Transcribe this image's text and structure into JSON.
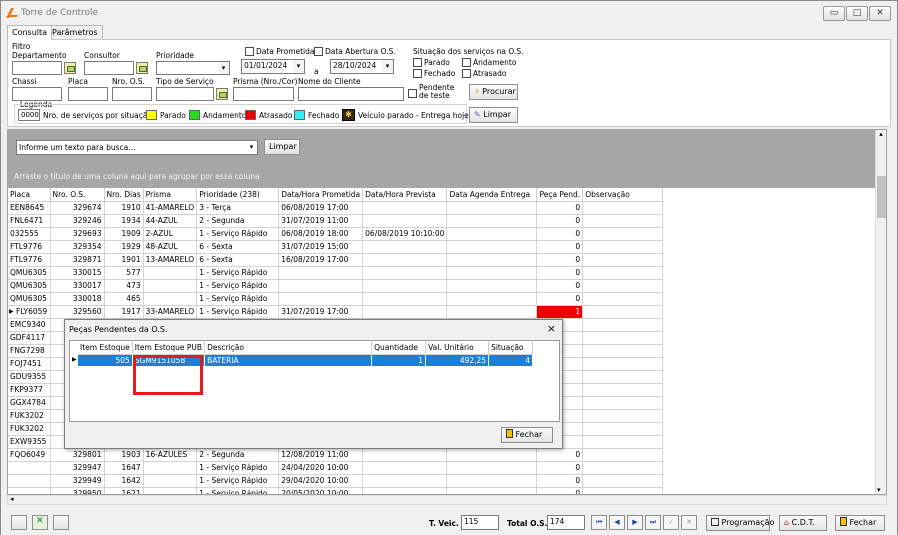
{
  "window": {
    "title": "Torre de Controle"
  },
  "tabs": [
    "Consulta",
    "Parâmetros"
  ],
  "filters": {
    "group_label": "Filtro",
    "departamento_label": "Departamento",
    "consultor_label": "Consultor",
    "prioridade_label": "Prioridade",
    "data_prometida_label": "Data Prometida",
    "data_abertura_label": "Data Abertura O.S.",
    "date_from": "01/01/2024",
    "date_sep": "a",
    "date_to": "28/10/2024",
    "situacao_label": "Situação dos serviços na O.S.",
    "parado": "Parado",
    "andamento": "Andamento",
    "fechado": "Fechado",
    "atrasado": "Atrasado",
    "chassi_label": "Chassi",
    "placa_label": "Placa",
    "nro_os_label": "Nro. O.S.",
    "tipo_servico_label": "Tipo de Serviço",
    "prisma_label": "Prisma (Nro./Cor)",
    "nome_cliente_label": "Nome do Cliente",
    "pendente_teste": "Pendente de teste",
    "procurar": "Procurar",
    "limpar": "Limpar"
  },
  "legend": {
    "title": "Legenda",
    "code": "0000",
    "code_text": "Nro. de serviços por situação",
    "items": [
      {
        "label": "Parado",
        "color": "#ffff00"
      },
      {
        "label": "Andamento",
        "color": "#22dd22"
      },
      {
        "label": "Atrasado",
        "color": "#ee0000"
      },
      {
        "label": "Fechado",
        "color": "#33eeee"
      }
    ],
    "vehicle_text": "Veículo parado - Entrega hoje"
  },
  "search": {
    "placeholder": "Informe um texto para busca...",
    "clear": "Limpar",
    "group_hint": "Arraste o título de uma coluna aqui para agrupar por essa coluna"
  },
  "grid": {
    "columns": [
      "Placa",
      "Nro. O.S.",
      "Nro. Dias",
      "Prisma",
      "Prioridade (238)",
      "Data/Hora Prometida",
      "Data/Hora Prevista",
      "Data Agenda Entrega",
      "Peça Pend.",
      "Observação"
    ],
    "rows": [
      [
        "EEN8645",
        "329674",
        "1910",
        "41-AMARELO",
        "3 - Terça",
        "06/08/2019 17:00",
        "",
        "",
        "0",
        ""
      ],
      [
        "FNL6471",
        "329246",
        "1934",
        "44-AZUL",
        "2 - Segunda",
        "31/07/2019 11:00",
        "",
        "",
        "0",
        ""
      ],
      [
        "032555",
        "329693",
        "1909",
        "2-AZUL",
        "1 - Serviço Rápido",
        "06/08/2019 18:00",
        "06/08/2019 10:10:00",
        "",
        "0",
        ""
      ],
      [
        "FTL9776",
        "329354",
        "1929",
        "48-AZUL",
        "6 - Sexta",
        "31/07/2019 15:00",
        "",
        "",
        "0",
        ""
      ],
      [
        "FTL9776",
        "329871",
        "1901",
        "13-AMARELO",
        "6 - Sexta",
        "16/08/2019 17:00",
        "",
        "",
        "0",
        ""
      ],
      [
        "QMU6305",
        "330015",
        "577",
        "",
        "1 - Serviço Rápido",
        "",
        "",
        "",
        "0",
        ""
      ],
      [
        "QMU6305",
        "330017",
        "473",
        "",
        "1 - Serviço Rápido",
        "",
        "",
        "",
        "0",
        ""
      ],
      [
        "QMU6305",
        "330018",
        "465",
        "",
        "1 - Serviço Rápido",
        "",
        "",
        "",
        "0",
        ""
      ],
      [
        "FLY6059",
        "329560",
        "1917",
        "33-AMARELO",
        "1 - Serviço Rápido",
        "31/07/2019 17:00",
        "",
        "",
        "1",
        ""
      ],
      [
        "EMC9340",
        "",
        "",
        "",
        "",
        "",
        "",
        "",
        "",
        ""
      ],
      [
        "GDF4117",
        "",
        "",
        "",
        "",
        "",
        "",
        "",
        "",
        ""
      ],
      [
        "FNG7298",
        "",
        "",
        "",
        "",
        "",
        "",
        "",
        "",
        ""
      ],
      [
        "FOJ7451",
        "",
        "",
        "",
        "",
        "",
        "",
        "",
        "",
        ""
      ],
      [
        "GDU9355",
        "",
        "",
        "",
        "",
        "",
        "",
        "",
        "",
        ""
      ],
      [
        "FKP9377",
        "",
        "",
        "",
        "",
        "",
        "",
        "",
        "",
        ""
      ],
      [
        "GGX4784",
        "",
        "",
        "",
        "",
        "",
        "",
        "",
        "",
        ""
      ],
      [
        "FUK3202",
        "",
        "",
        "",
        "",
        "",
        "",
        "",
        "",
        ""
      ],
      [
        "FUK3202",
        "",
        "",
        "",
        "",
        "",
        "",
        "",
        "",
        ""
      ],
      [
        "EXW9355",
        "",
        "",
        "",
        "",
        "",
        "",
        "",
        "",
        ""
      ],
      [
        "FQO6049",
        "329801",
        "1903",
        "16-AZULES",
        "2 - Segunda",
        "12/08/2019 11:00",
        "",
        "",
        "0",
        ""
      ],
      [
        "",
        "329947",
        "1647",
        "",
        "1 - Serviço Rápido",
        "24/04/2020 10:00",
        "",
        "",
        "0",
        ""
      ],
      [
        "",
        "329949",
        "1642",
        "",
        "1 - Serviço Rápido",
        "29/04/2020 10:00",
        "",
        "",
        "0",
        ""
      ],
      [
        "",
        "329950",
        "1621",
        "",
        "1 - Serviço Rápido",
        "20/05/2020 10:00",
        "",
        "",
        "0",
        ""
      ]
    ]
  },
  "dialog": {
    "title": "Peças Pendentes da O.S.",
    "close": "×",
    "columns": [
      "Item Estoque",
      "Item Estoque PUB",
      "Descrição",
      "Quantidade",
      "Val. Unitário",
      "Situação"
    ],
    "rows": [
      [
        "505",
        "SGM9151058",
        "BATERIA",
        "1",
        "492,25",
        "4"
      ]
    ],
    "fechar": "Fechar"
  },
  "statusbar": {
    "t_veic_label": "T. Veic.",
    "t_veic_value": "115",
    "total_os_label": "Total O.S.",
    "total_os_value": "174",
    "programacao": "Programação",
    "cdt": "C.D.T.",
    "fechar": "Fechar"
  }
}
